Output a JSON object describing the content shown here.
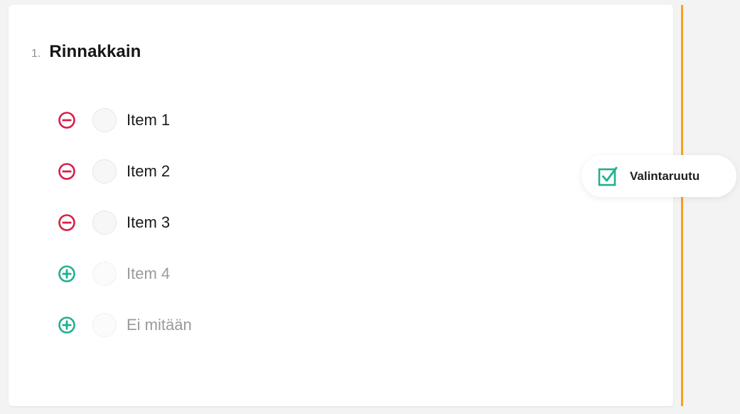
{
  "question": {
    "number": "1.",
    "title": "Rinnakkain"
  },
  "items": [
    {
      "label": "Item 1",
      "enabled": true,
      "toggle_icon": "minus-circle-icon"
    },
    {
      "label": "Item 2",
      "enabled": true,
      "toggle_icon": "minus-circle-icon"
    },
    {
      "label": "Item 3",
      "enabled": true,
      "toggle_icon": "minus-circle-icon"
    },
    {
      "label": "Item 4",
      "enabled": false,
      "toggle_icon": "plus-circle-icon"
    },
    {
      "label": "Ei mitään",
      "enabled": false,
      "toggle_icon": "plus-circle-icon"
    }
  ],
  "question_type": {
    "label": "Valintaruutu",
    "icon": "checkbox-checked-icon"
  },
  "colors": {
    "remove": "#d81e48",
    "add": "#20b08f",
    "accent_line": "#f5a021",
    "checkbox_icon": "#20b08f"
  }
}
